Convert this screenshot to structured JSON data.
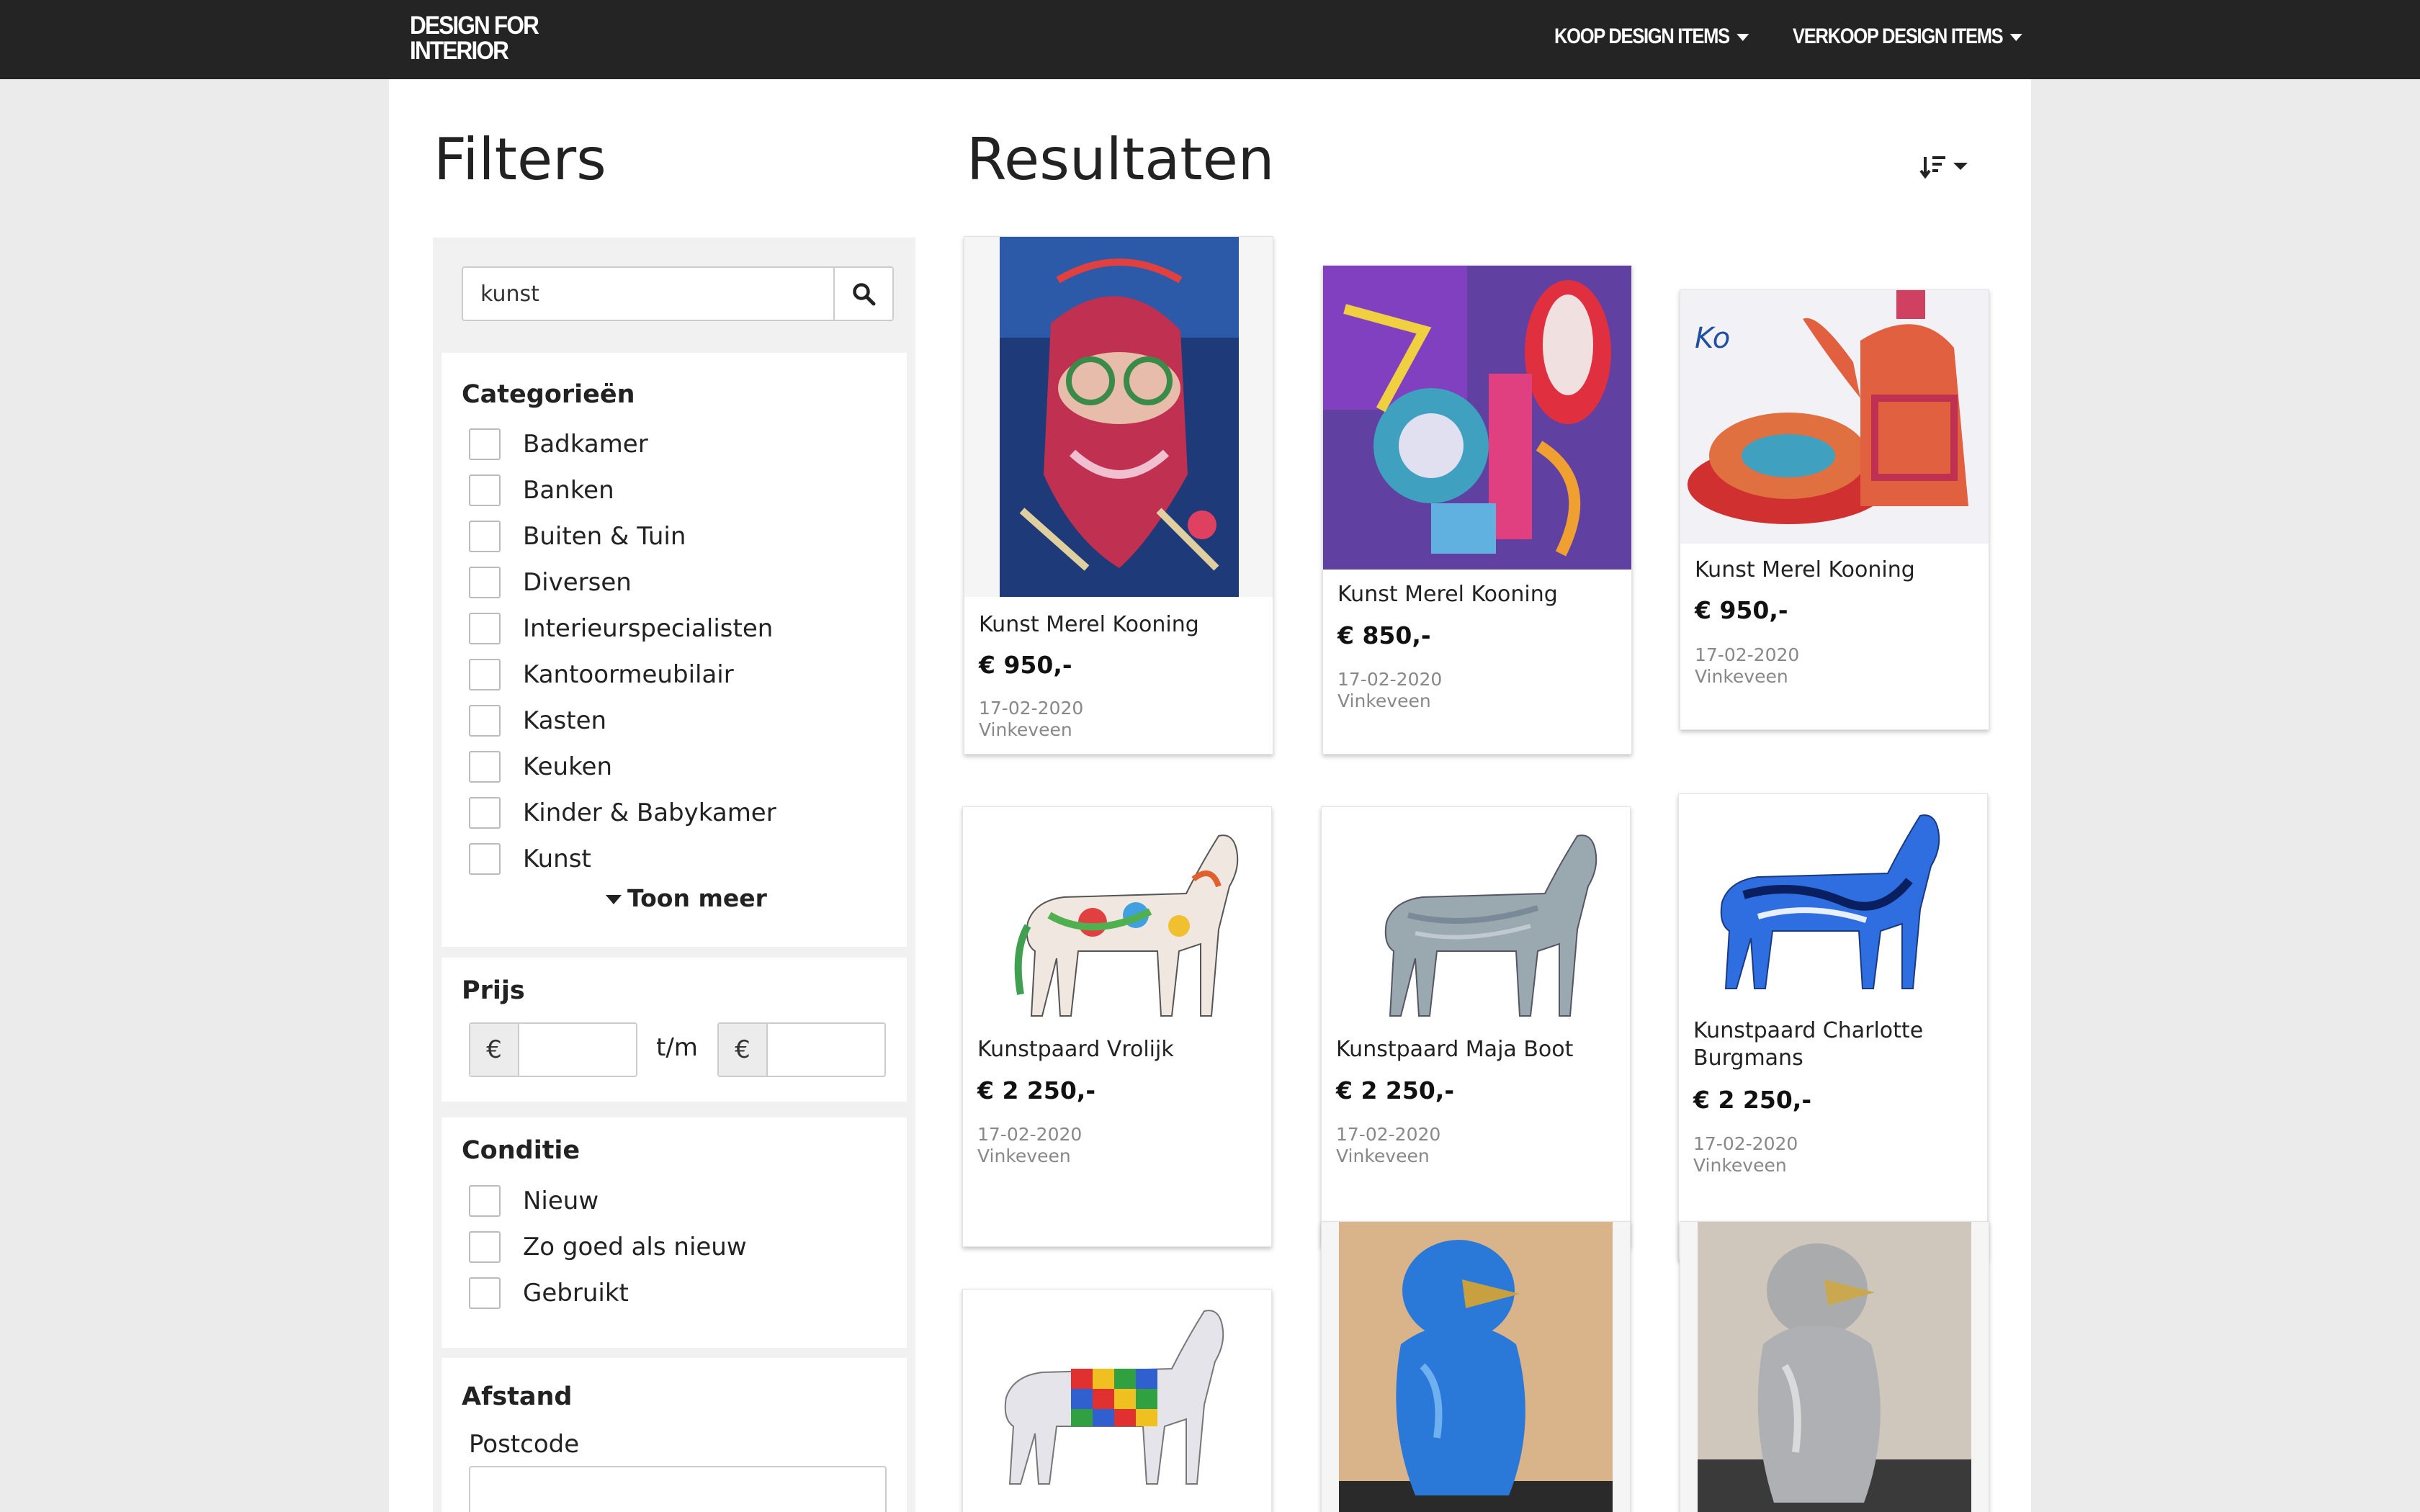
{
  "nav": {
    "logo_line1": "DESIGN FOR",
    "logo_line2": "INTERIOR",
    "koop": "KOOP DESIGN ITEMS",
    "verkoop": "VERKOOP DESIGN ITEMS"
  },
  "filters": {
    "title": "Filters",
    "search_value": "kunst",
    "categories_title": "Categorieën",
    "categories": [
      "Badkamer",
      "Banken",
      "Buiten & Tuin",
      "Diversen",
      "Interieurspecialisten",
      "Kantoormeubilair",
      "Kasten",
      "Keuken",
      "Kinder & Babykamer",
      "Kunst"
    ],
    "toon_meer": "Toon meer",
    "prijs_title": "Prijs",
    "currency": "€",
    "tm": "t/m",
    "conditie_title": "Conditie",
    "condities": [
      "Nieuw",
      "Zo goed als nieuw",
      "Gebruikt"
    ],
    "afstand_title": "Afstand",
    "postcode_label": "Postcode"
  },
  "results": {
    "title": "Resultaten",
    "items": [
      {
        "title": "Kunst Merel Kooning",
        "price": "€ 950,-",
        "date": "17-02-2020",
        "location": "Vinkeveen"
      },
      {
        "title": "Kunst Merel Kooning",
        "price": "€ 850,-",
        "date": "17-02-2020",
        "location": "Vinkeveen"
      },
      {
        "title": "Kunst Merel Kooning",
        "price": "€ 950,-",
        "date": "17-02-2020",
        "location": "Vinkeveen"
      },
      {
        "title": "Kunstpaard Vrolijk",
        "price": "€ 2 250,-",
        "date": "17-02-2020",
        "location": "Vinkeveen"
      },
      {
        "title": "Kunstpaard Maja Boot",
        "price": "€ 2 250,-",
        "date": "17-02-2020",
        "location": "Vinkeveen"
      },
      {
        "title": "Kunstpaard Charlotte Burgmans",
        "price": "€ 2 250,-",
        "date": "17-02-2020",
        "location": "Vinkeveen"
      }
    ]
  }
}
